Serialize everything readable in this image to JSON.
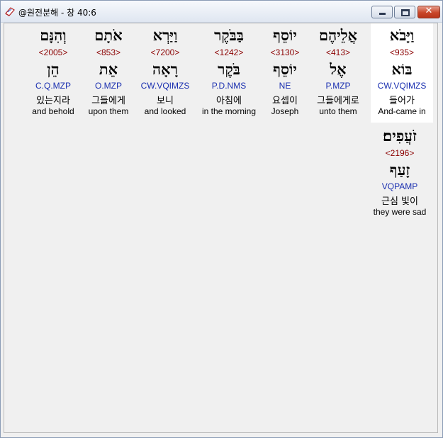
{
  "window": {
    "title": "@원전분해 - 창 40:6",
    "icons": {
      "app": "book-icon",
      "minimize": "minimize-icon",
      "maximize": "maximize-icon",
      "close": "close-icon"
    },
    "close_glyph": "✕"
  },
  "colors": {
    "strong": "#8b0000",
    "morph": "#1a2fb0",
    "selected_bg": "#ffffff"
  },
  "words": [
    {
      "hebrew": "וַיָּבֹא",
      "strong": "<935>",
      "root": "בּוֹא",
      "morph": "CW.VQIMZS",
      "korean": "들어가",
      "english": "And-came in",
      "selected": true
    },
    {
      "hebrew": "אֲלֵיהֶם",
      "strong": "<413>",
      "root": "אֶל",
      "morph": "P.MZP",
      "korean": "그들에게로",
      "english": "unto them",
      "selected": false
    },
    {
      "hebrew": "יוֹסֵף",
      "strong": "<3130>",
      "root": "יוֹסֵף",
      "morph": "NE",
      "korean": "요셉이",
      "english": "Joseph",
      "selected": false
    },
    {
      "hebrew": "בַּבֹּקֶר",
      "strong": "<1242>",
      "root": "בֹּקֶר",
      "morph": "P.D.NMS",
      "korean": "아침에",
      "english": "in the morning",
      "selected": false
    },
    {
      "hebrew": "וַיַּרְא",
      "strong": "<7200>",
      "root": "רָאָה",
      "morph": "CW.VQIMZS",
      "korean": "보니",
      "english": "and looked",
      "selected": false
    },
    {
      "hebrew": "אֹתָם",
      "strong": "<853>",
      "root": "אֵת",
      "morph": "O.MZP",
      "korean": "그들에게",
      "english": "upon them",
      "selected": false
    },
    {
      "hebrew": "וְהִנָּם",
      "strong": "<2005>",
      "root": "הֵן",
      "morph": "C.Q.MZP",
      "korean": "있는지라",
      "english": "and behold",
      "selected": false
    },
    {
      "hebrew": "זֹעֲפִים׃",
      "strong": "<2196>",
      "root": "זָעַף",
      "morph": "VQPAMP",
      "korean": "근심 빛이",
      "english": "they were sad",
      "selected": false
    }
  ]
}
